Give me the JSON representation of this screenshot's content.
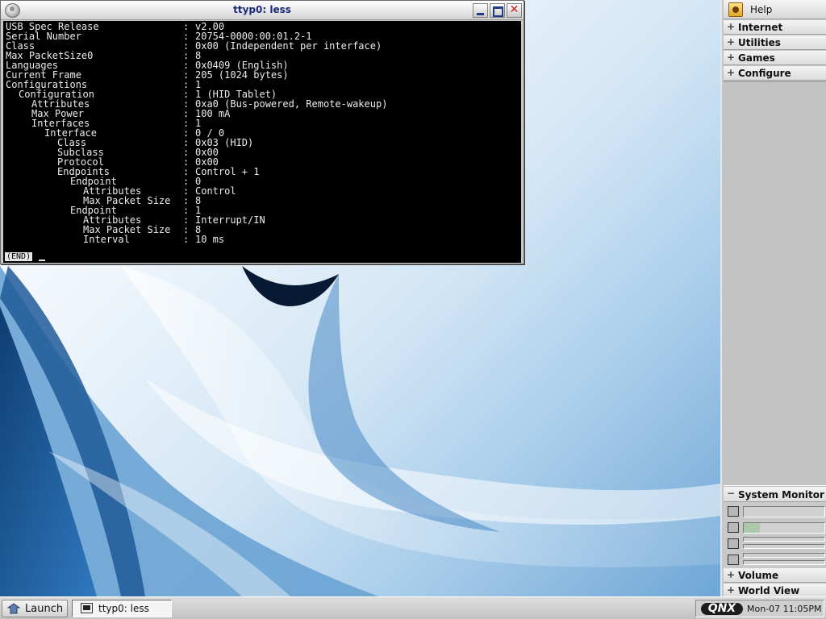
{
  "window": {
    "title": "ttyp0: less",
    "end_marker": "(END)",
    "lines": [
      {
        "indent": 0,
        "key": "USB Spec Release",
        "value": "v2.00"
      },
      {
        "indent": 0,
        "key": "Serial Number",
        "value": "20754-0000:00:01.2-1"
      },
      {
        "indent": 0,
        "key": "Class",
        "value": "0x00 (Independent per interface)"
      },
      {
        "indent": 0,
        "key": "Max PacketSize0",
        "value": "8"
      },
      {
        "indent": 0,
        "key": "Languages",
        "value": "0x0409 (English)"
      },
      {
        "indent": 0,
        "key": "Current Frame",
        "value": "205 (1024 bytes)"
      },
      {
        "indent": 0,
        "key": "Configurations",
        "value": "1"
      },
      {
        "indent": 1,
        "key": "Configuration",
        "value": "1 (HID Tablet)"
      },
      {
        "indent": 2,
        "key": "Attributes",
        "value": "0xa0 (Bus-powered, Remote-wakeup)"
      },
      {
        "indent": 2,
        "key": "Max Power",
        "value": "100 mA"
      },
      {
        "indent": 2,
        "key": "Interfaces",
        "value": "1"
      },
      {
        "indent": 3,
        "key": "Interface",
        "value": "0 / 0"
      },
      {
        "indent": 4,
        "key": "Class",
        "value": "0x03 (HID)"
      },
      {
        "indent": 4,
        "key": "Subclass",
        "value": "0x00"
      },
      {
        "indent": 4,
        "key": "Protocol",
        "value": "0x00"
      },
      {
        "indent": 4,
        "key": "Endpoints",
        "value": "Control + 1"
      },
      {
        "indent": 5,
        "key": "Endpoint",
        "value": "0"
      },
      {
        "indent": 6,
        "key": "Attributes",
        "value": "Control"
      },
      {
        "indent": 6,
        "key": "Max Packet Size",
        "value": "8"
      },
      {
        "indent": 5,
        "key": "Endpoint",
        "value": "1"
      },
      {
        "indent": 6,
        "key": "Attributes",
        "value": "Interrupt/IN"
      },
      {
        "indent": 6,
        "key": "Max Packet Size",
        "value": "8"
      },
      {
        "indent": 6,
        "key": "Interval",
        "value": "10 ms"
      }
    ]
  },
  "shelf": {
    "help": "Help",
    "items": [
      {
        "label": "Internet",
        "expander": "+"
      },
      {
        "label": "Utilities",
        "expander": "+"
      },
      {
        "label": "Games",
        "expander": "+"
      },
      {
        "label": "Configure",
        "expander": "+"
      }
    ],
    "system_monitor": {
      "label": "System Monitor",
      "expander": "−",
      "memory_usage": 0.2
    },
    "bottom_items": [
      {
        "label": "Volume",
        "expander": "+"
      },
      {
        "label": "World View",
        "expander": "+"
      }
    ]
  },
  "taskbar": {
    "launch": "Launch",
    "tasks": [
      {
        "label": "ttyp0: less"
      }
    ],
    "logo": "QNX",
    "clock": "Mon-07  11:05PM"
  },
  "colors": {
    "terminal_bg": "#000000",
    "terminal_fg": "#ececec",
    "title_text": "#1a2a7a",
    "close_accent": "#c81d1d"
  }
}
